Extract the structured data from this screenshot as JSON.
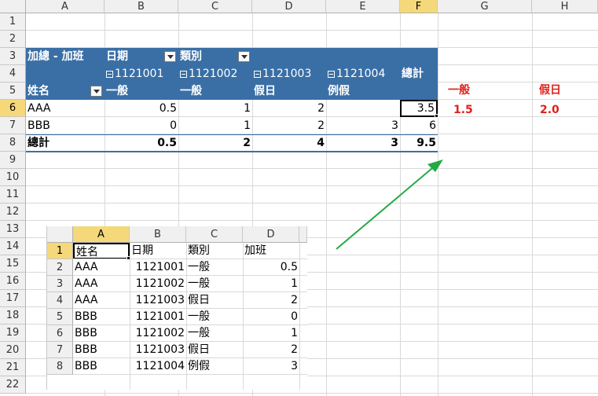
{
  "col_headers": [
    "A",
    "B",
    "C",
    "D",
    "E",
    "F",
    "G",
    "H"
  ],
  "row_headers": [
    "1",
    "2",
    "3",
    "4",
    "5",
    "6",
    "7",
    "8",
    "9",
    "10",
    "11",
    "12",
    "13",
    "14",
    "15",
    "16",
    "17",
    "18",
    "19",
    "20",
    "21",
    "22"
  ],
  "pivot": {
    "title": "加總 - 加班",
    "date_field": "日期",
    "category_field": "類別",
    "dates": [
      "1121001",
      "1121002",
      "1121003",
      "1121004"
    ],
    "grand_total_label": "總計",
    "row_field": "姓名",
    "subheaders": [
      "一般",
      "一般",
      "假日",
      "例假"
    ],
    "rows": [
      {
        "name": "AAA",
        "values": [
          "0.5",
          "1",
          "2",
          ""
        ],
        "total": "3.5"
      },
      {
        "name": "BBB",
        "values": [
          "0",
          "1",
          "2",
          "3"
        ],
        "total": "6"
      }
    ],
    "totals": {
      "label": "總計",
      "values": [
        "0.5",
        "2",
        "4",
        "3"
      ],
      "total": "9.5"
    }
  },
  "side": {
    "labels": [
      "一般",
      "假日"
    ],
    "values": [
      "1.5",
      "2.0"
    ]
  },
  "inset": {
    "col_headers": [
      "A",
      "B",
      "C",
      "D"
    ],
    "row_headers": [
      "1",
      "2",
      "3",
      "4",
      "5",
      "6",
      "7",
      "8"
    ],
    "header": [
      "姓名",
      "日期",
      "類別",
      "加班"
    ],
    "rows": [
      [
        "AAA",
        "1121001",
        "一般",
        "0.5"
      ],
      [
        "AAA",
        "1121002",
        "一般",
        "1"
      ],
      [
        "AAA",
        "1121003",
        "假日",
        "2"
      ],
      [
        "BBB",
        "1121001",
        "一般",
        "0"
      ],
      [
        "BBB",
        "1121002",
        "一般",
        "1"
      ],
      [
        "BBB",
        "1121003",
        "假日",
        "2"
      ],
      [
        "BBB",
        "1121004",
        "例假",
        "3"
      ]
    ]
  },
  "colors": {
    "pivot_header": "#3a6fa6",
    "red_text": "#e0201b",
    "arrow": "#22aa44",
    "selected_header": "#f5d87a"
  }
}
